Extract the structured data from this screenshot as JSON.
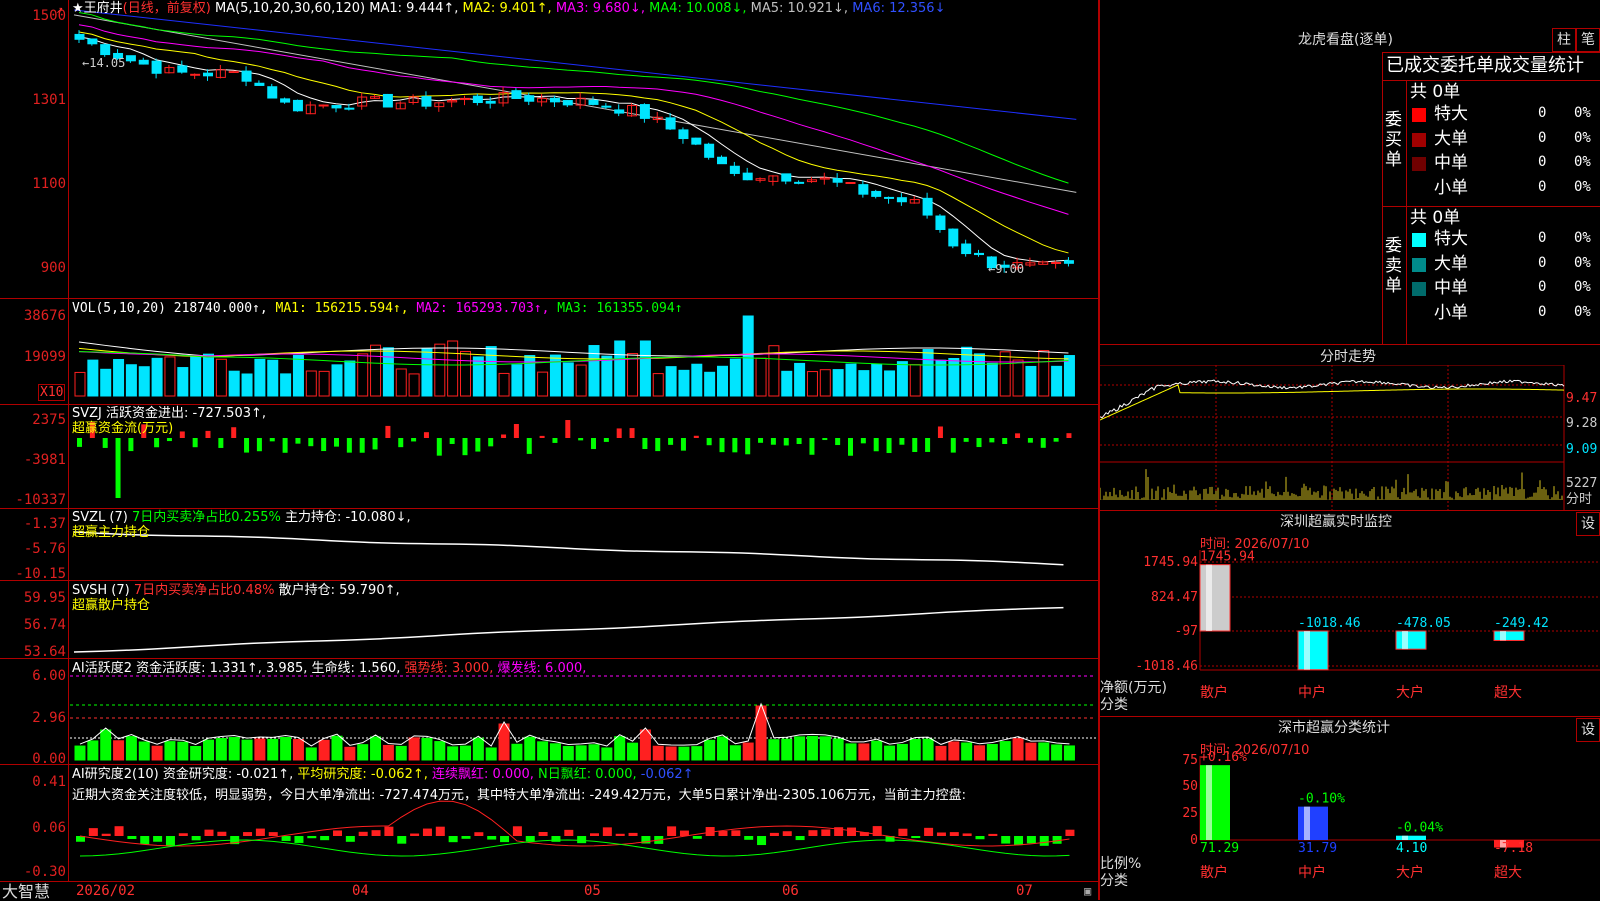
{
  "colors": {
    "up": "#ff2020",
    "down": "#00e5ff",
    "green_bar": "#00ff00",
    "frame": "#b00000",
    "ma1": "#ffffff",
    "ma2": "#ffff00",
    "ma3": "#ff00ff",
    "ma4": "#00ff00",
    "ma5": "#c0c0c0",
    "ma6": "#1e2fff"
  },
  "main": {
    "corner_mark": "↗",
    "title_star": "★王府井",
    "title_type": "(日线，前复权)",
    "ma_params": "MA(5,10,20,30,60,120)",
    "ma1": "MA1: 9.444↑,",
    "ma2": "MA2: 9.401↑,",
    "ma3": "MA3: 9.680↓,",
    "ma4": "MA4: 10.008↓,",
    "ma5": "MA5: 10.921↓,",
    "ma6": "MA6: 12.356↓",
    "y_labels": [
      "1500",
      "1301",
      "1100",
      "900"
    ],
    "high_label": "←14.05",
    "low_label": "←9.00"
  },
  "vol": {
    "title": "VOL(5,10,20)",
    "value": "218740.000↑,",
    "ma1": "MA1: 156215.594↑,",
    "ma2": "MA2: 165293.703↑,",
    "ma3": "MA3: 161355.094↑",
    "y_labels": [
      "38676",
      "19099"
    ],
    "unit": "X10"
  },
  "svzj": {
    "title": "SVZJ",
    "text": "活跃资金进出: -727.503↑,",
    "sub": "超赢资金流(万元)",
    "y_labels": [
      "2375",
      "-3981",
      "-10337"
    ]
  },
  "svzl": {
    "title": "SVZL (7)",
    "ratio": "7日内买卖净占比0.255%",
    "text": "主力持仓: -10.080↓,",
    "sub": "超赢主力持仓",
    "y_labels": [
      "-1.37",
      "-5.76",
      "-10.15"
    ]
  },
  "svsh": {
    "title": "SVSH (7)",
    "ratio": "7日内买卖净占比0.48%",
    "text": "散户持仓: 59.790↑,",
    "sub": "超赢散户持仓",
    "y_labels": [
      "59.95",
      "56.74",
      "53.64"
    ]
  },
  "ai_active": {
    "title": "AI活跃度2",
    "text": "资金活跃度: 1.331↑, 3.985, 生命线: 1.560,",
    "strong": "强势线: 3.000,",
    "burst": "爆发线: 6.000,",
    "y_labels": [
      "6.00",
      "2.96",
      "0.00"
    ]
  },
  "ai_research": {
    "title": "AI研究度2(10)",
    "text": "资金研究度: -0.021↑,",
    "avg": "平均研究度: -0.062↑,",
    "red": "连续飘红: 0.000,",
    "nred": "N日飘红: 0.000,",
    "tail": "-0.062↑",
    "comment": "近期大资金关注度较低，明显弱势，今日大单净流出: -727.474万元，其中特大单净流出: -249.42万元，大单5日累计净出-2305.106万元，当前主力控盘:",
    "y_labels": [
      "0.41",
      "0.06",
      "-0.30"
    ]
  },
  "bottom": {
    "brand": "大智慧",
    "dates": [
      "2026/02",
      "04",
      "05",
      "06",
      "07"
    ]
  },
  "dragon": {
    "title": "龙虎看盘(逐单)",
    "btn1": "柱",
    "btn2": "笔",
    "header": "已成交委托单成交量统计",
    "buy_label": "委买单",
    "sell_label": "委卖单",
    "buy_total": "共 0单",
    "sell_total": "共 0单",
    "buy_rows": [
      {
        "name": "特大",
        "vol": "0",
        "pct": "0%",
        "color": "#ff0000"
      },
      {
        "name": "大单",
        "vol": "0",
        "pct": "0%",
        "color": "#a00000"
      },
      {
        "name": "中单",
        "vol": "0",
        "pct": "0%",
        "color": "#700000"
      },
      {
        "name": "小单",
        "vol": "0",
        "pct": "0%",
        "color": "#000000"
      }
    ],
    "sell_rows": [
      {
        "name": "特大",
        "vol": "0",
        "pct": "0%",
        "color": "#00ffff"
      },
      {
        "name": "大单",
        "vol": "0",
        "pct": "0%",
        "color": "#008b8b"
      },
      {
        "name": "中单",
        "vol": "0",
        "pct": "0%",
        "color": "#006b6b"
      },
      {
        "name": "小单",
        "vol": "0",
        "pct": "0%",
        "color": "#000000"
      }
    ]
  },
  "intraday": {
    "title": "分时走势",
    "prices": [
      "9.47",
      "9.28",
      "9.09"
    ],
    "vol_label": "5227",
    "vol_unit": "分时"
  },
  "monitor": {
    "title": "深圳超赢实时监控",
    "btn": "设",
    "time": "时间: 2026/07/10",
    "y_labels": [
      "1745.94",
      "824.47",
      "-97",
      "-1018.46"
    ],
    "axis_title": "净额(万元)",
    "axis_sub": "分类",
    "categories": [
      "散户",
      "中户",
      "大户",
      "超大"
    ],
    "values": [
      1745.94,
      -1018.46,
      -478.05,
      -249.42
    ],
    "value_labels": [
      "1745.94",
      "-1018.46",
      "-478.05",
      "-249.42"
    ]
  },
  "stats": {
    "title": "深市超赢分类统计",
    "btn": "设",
    "time": "时间: 2026/07/10",
    "y_labels": [
      "75",
      "50",
      "25",
      "0"
    ],
    "axis_title": "比例%",
    "axis_sub": "分类",
    "categories": [
      "散户",
      "中户",
      "大户",
      "超大"
    ],
    "values": [
      71.29,
      31.79,
      4.1,
      -7.18
    ],
    "value_labels": [
      "71.29",
      "31.79",
      "4.10",
      "-7.18"
    ],
    "change_labels": [
      "+0.16%",
      "-0.10%",
      "-0.04%",
      ""
    ]
  }
}
